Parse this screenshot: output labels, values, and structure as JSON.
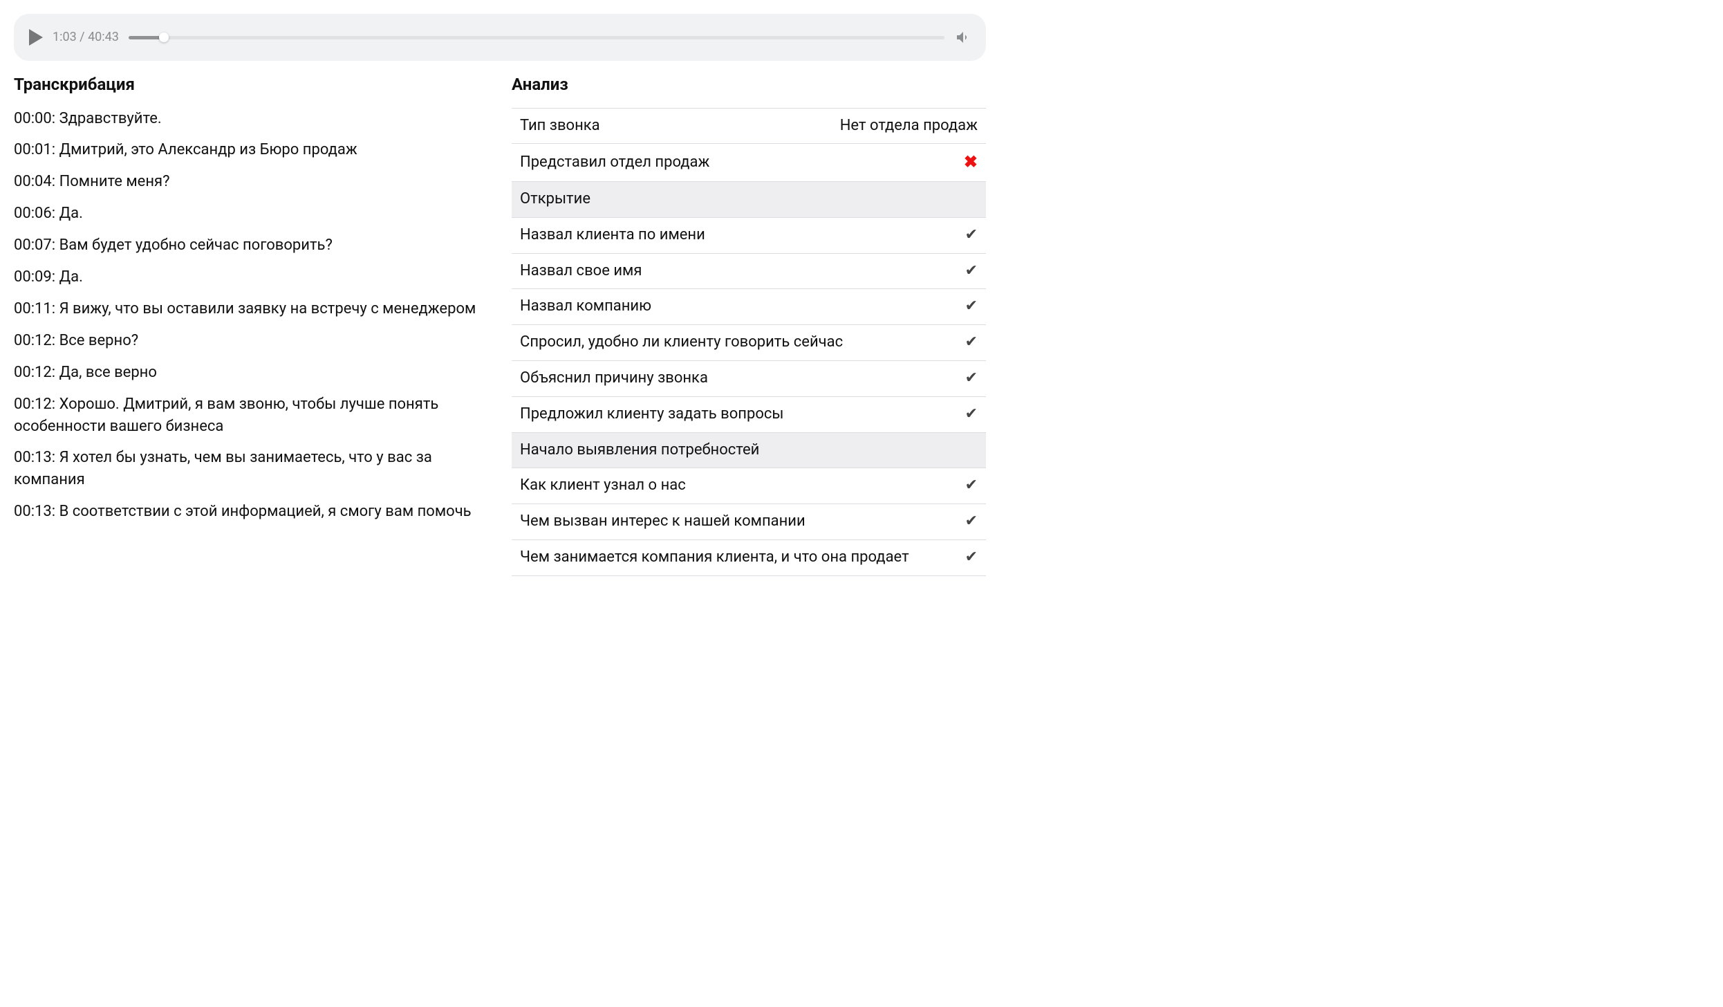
{
  "player": {
    "current_time": "1:03",
    "total_time": "40:43",
    "time_display": "1:03 / 40:43"
  },
  "left": {
    "title": "Транскрибация",
    "lines": [
      "00:00: Здравствуйте.",
      "00:01: Дмитрий, это Александр из Бюро продаж",
      "00:04: Помните меня?",
      "00:06: Да.",
      "00:07: Вам будет удобно сейчас поговорить?",
      "00:09: Да.",
      "00:11: Я вижу, что вы оставили заявку на встречу с менеджером",
      "00:12: Все верно?",
      "00:12: Да, все верно",
      "00:12: Хорошо. Дмитрий, я вам звоню, чтобы лучше понять особенности вашего бизнеса",
      "00:13: Я хотел бы узнать, чем вы занимаетесь, что у вас за компания",
      "00:13: В соответствии с этой информацией, я смогу вам помочь"
    ]
  },
  "right": {
    "title": "Анализ",
    "rows": [
      {
        "type": "kv",
        "label": "Тип звонка",
        "value": "Нет отдела продаж"
      },
      {
        "type": "cross",
        "label": "Представил отдел продаж"
      },
      {
        "type": "section",
        "label": "Открытие"
      },
      {
        "type": "check",
        "label": "Назвал клиента по имени"
      },
      {
        "type": "check",
        "label": "Назвал свое имя"
      },
      {
        "type": "check",
        "label": "Назвал компанию"
      },
      {
        "type": "check",
        "label": "Спросил, удобно ли клиенту говорить сейчас"
      },
      {
        "type": "check",
        "label": "Объяснил причину звонка"
      },
      {
        "type": "check",
        "label": "Предложил клиенту задать вопросы"
      },
      {
        "type": "section",
        "label": "Начало выявления потребностей"
      },
      {
        "type": "check",
        "label": "Как клиент узнал о нас"
      },
      {
        "type": "check",
        "label": "Чем вызван интерес к нашей компании"
      },
      {
        "type": "check",
        "label": "Чем занимается компания клиента, и что она продает"
      }
    ]
  },
  "glyphs": {
    "check": "✔",
    "cross": "✖"
  }
}
